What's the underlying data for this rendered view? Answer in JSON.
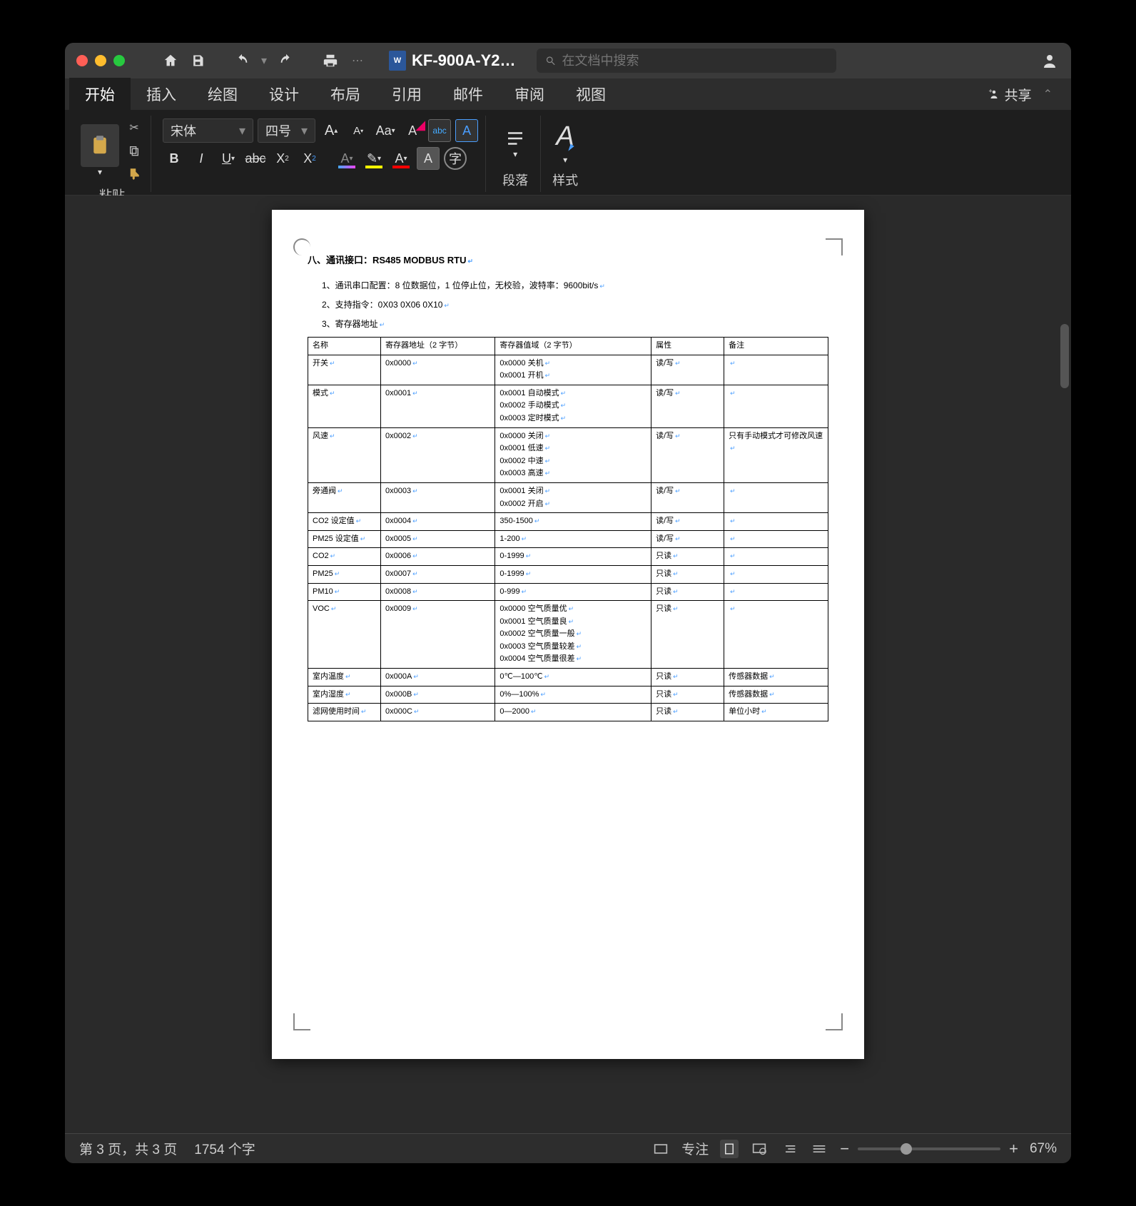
{
  "titlebar": {
    "doc_name": "KF-900A-Y2…",
    "search_placeholder": "在文档中搜索"
  },
  "tabs": {
    "items": [
      "开始",
      "插入",
      "绘图",
      "设计",
      "布局",
      "引用",
      "邮件",
      "审阅",
      "视图"
    ],
    "share": "共享"
  },
  "ribbon": {
    "paste": "粘贴",
    "font_name": "宋体",
    "font_size": "四号",
    "paragraph": "段落",
    "styles": "样式"
  },
  "document": {
    "heading": "八、通讯接口：RS485   MODBUS   RTU",
    "li1": "1、通讯串口配置：8 位数据位，1 位停止位，无校验，波特率：9600bit/s",
    "li2": "2、支持指令：0X03   0X06   0X10",
    "li3": "3、寄存器地址",
    "table_headers": [
      "名称",
      "寄存器地址（2 字节）",
      "寄存器值域（2 字节）",
      "属性",
      "备注"
    ],
    "rows": [
      {
        "name": "开关",
        "addr": "0x0000",
        "val": "0x0000 关机\n0x0001 开机",
        "attr": "读/写",
        "note": ""
      },
      {
        "name": "模式",
        "addr": "0x0001",
        "val": "0x0001 自动模式\n0x0002 手动模式\n0x0003 定时模式",
        "attr": "读/写",
        "note": ""
      },
      {
        "name": "风速",
        "addr": "0x0002",
        "val": "0x0000 关闭\n0x0001 低速\n0x0002 中速\n0x0003 高速",
        "attr": "读/写",
        "note": "只有手动模式才可修改风速"
      },
      {
        "name": "旁通阀",
        "addr": "0x0003",
        "val": "0x0001 关闭\n0x0002 开启",
        "attr": "读/写",
        "note": ""
      },
      {
        "name": "CO2 设定值",
        "addr": "0x0004",
        "val": "350-1500",
        "attr": "读/写",
        "note": ""
      },
      {
        "name": "PM25 设定值",
        "addr": "0x0005",
        "val": "1-200",
        "attr": "读/写",
        "note": ""
      },
      {
        "name": "CO2",
        "addr": "0x0006",
        "val": "0-1999",
        "attr": "只读",
        "note": ""
      },
      {
        "name": "PM25",
        "addr": "0x0007",
        "val": "0-1999",
        "attr": "只读",
        "note": ""
      },
      {
        "name": "PM10",
        "addr": "0x0008",
        "val": "0-999",
        "attr": "只读",
        "note": ""
      },
      {
        "name": "VOC",
        "addr": "0x0009",
        "val": "0x0000    空气质量优\n0x0001    空气质量良\n0x0002    空气质量一般\n0x0003    空气质量较差\n0x0004    空气质量很差",
        "attr": "只读",
        "note": ""
      },
      {
        "name": "室内温度",
        "addr": "0x000A",
        "val": "0℃—100℃",
        "attr": "只读",
        "note": "传感器数据"
      },
      {
        "name": "室内湿度",
        "addr": "0x000B",
        "val": "0%—100%",
        "attr": "只读",
        "note": "传感器数据"
      },
      {
        "name": "滤网使用时间",
        "addr": "0x000C",
        "val": "0—2000",
        "attr": "只读",
        "note": "单位小时"
      }
    ]
  },
  "statusbar": {
    "page": "第 3 页，共 3 页",
    "words": "1754 个字",
    "focus": "专注",
    "zoom": "67%"
  }
}
